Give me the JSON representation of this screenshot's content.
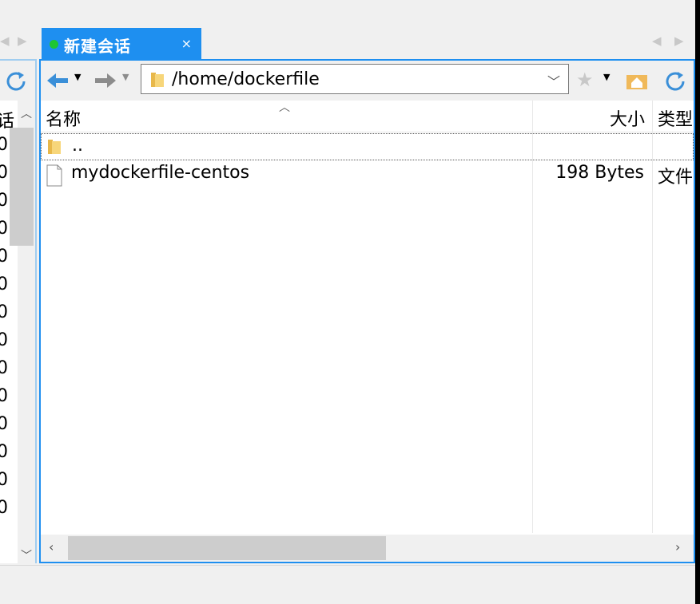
{
  "tabs": [
    {
      "label": "新建会话",
      "active": true,
      "status_color": "#1ec633",
      "close_label": "×"
    }
  ],
  "colors": {
    "accent": "#1e8ff0",
    "connected": "#1ec633"
  },
  "left_pane": {
    "header_fragment": "话",
    "rows": [
      "0",
      "0",
      "0",
      "0",
      "0",
      "0",
      "0",
      "0",
      "0",
      "0",
      "0",
      "0",
      "0",
      "0"
    ]
  },
  "toolbar": {
    "back_icon": "arrow-left-icon",
    "forward_icon": "arrow-right-icon",
    "bookmark_icon": "star-icon",
    "home_icon": "home-folder-icon",
    "refresh_icon": "refresh-icon"
  },
  "path": {
    "value": "/home/dockerfile"
  },
  "columns": {
    "name": "名称",
    "size": "大小",
    "type": "类型"
  },
  "files": [
    {
      "name": "..",
      "size": "",
      "type": "",
      "icon": "folder-icon"
    },
    {
      "name": "mydockerfile-centos",
      "size": "198 Bytes",
      "type": "文件",
      "icon": "file-icon"
    }
  ]
}
